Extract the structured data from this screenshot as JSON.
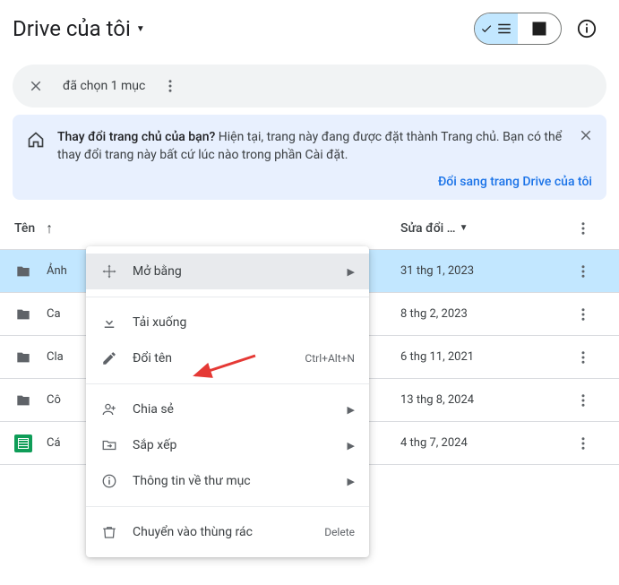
{
  "header": {
    "title": "Drive của tôi"
  },
  "selection": {
    "text": "đã chọn 1 mục"
  },
  "banner": {
    "bold": "Thay đổi trang chủ của bạn?",
    "text": " Hiện tại, trang này đang được đặt thành Trang chủ. Bạn có thể thay đổi trang này bất cứ lúc nào trong phần Cài đặt.",
    "action": "Đổi sang trang Drive của tôi"
  },
  "columns": {
    "name": "Tên",
    "date": "Sửa đổi …"
  },
  "rows": [
    {
      "name": "Ảnh",
      "date": "31 thg 1, 2023",
      "type": "folder",
      "selected": true
    },
    {
      "name": "Ca",
      "date": "8 thg 2, 2023",
      "type": "folder",
      "selected": false
    },
    {
      "name": "Cla",
      "date": "6 thg 11, 2021",
      "type": "folder",
      "selected": false
    },
    {
      "name": "Cô",
      "date": "13 thg 8, 2024",
      "type": "folder",
      "selected": false
    },
    {
      "name": "Cá",
      "date": "4 thg 7, 2024",
      "type": "sheet",
      "selected": false
    }
  ],
  "menu": {
    "open": "Mở bằng",
    "download": "Tải xuống",
    "rename": "Đổi tên",
    "rename_shortcut": "Ctrl+Alt+N",
    "share": "Chia sẻ",
    "organize": "Sắp xếp",
    "info": "Thông tin về thư mục",
    "trash": "Chuyển vào thùng rác",
    "trash_shortcut": "Delete"
  }
}
